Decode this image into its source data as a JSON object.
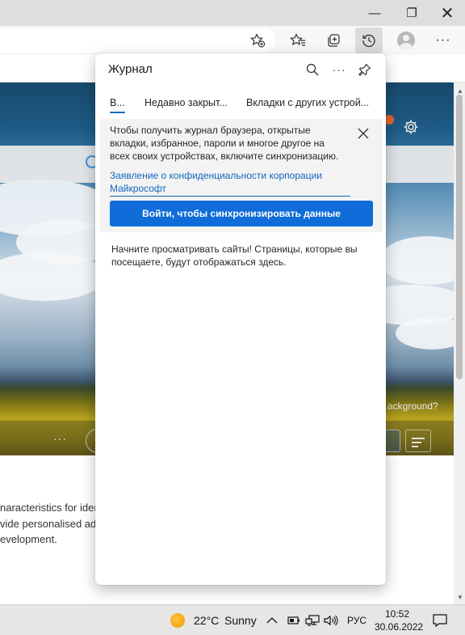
{
  "window": {
    "minimize_glyph": "—",
    "maximize_glyph": "❐",
    "close_glyph": "✕"
  },
  "toolbar": {
    "more_glyph": "···",
    "icons": [
      "add-favorite-icon",
      "favorites-icon",
      "collections-icon",
      "history-icon",
      "profile-icon",
      "more-icon"
    ]
  },
  "background_page": {
    "hero_caption": "ackground?",
    "dots": "···",
    "text_lines": [
      "naracteristics for iden",
      "vide personalised ads",
      "evelopment."
    ]
  },
  "history_panel": {
    "title": "Журнал",
    "more_glyph": "···",
    "tabs": [
      {
        "label": "В...",
        "selected": true
      },
      {
        "label": "Недавно закрыт...",
        "selected": false
      },
      {
        "label": "Вкладки с других устрой...",
        "selected": false
      }
    ],
    "sync_message": "Чтобы получить журнал браузера, открытые вкладки, избранное, пароли и многое другое на всех своих устройствах, включите синхронизацию.",
    "privacy_link": "Заявление о конфиденциальности корпорации Майкрософт",
    "sync_button": "Войти, чтобы синхронизировать данные",
    "empty_message": "Начните просматривать сайты! Страницы, которые вы посещаете, будут отображаться здесь."
  },
  "taskbar": {
    "temperature": "22°C",
    "condition": "Sunny",
    "chevron_glyph": "^",
    "language": "РУС",
    "time": "10:52",
    "date": "30.06.2022"
  },
  "colors": {
    "accent": "#0f6cd8",
    "link": "#1565c0"
  }
}
